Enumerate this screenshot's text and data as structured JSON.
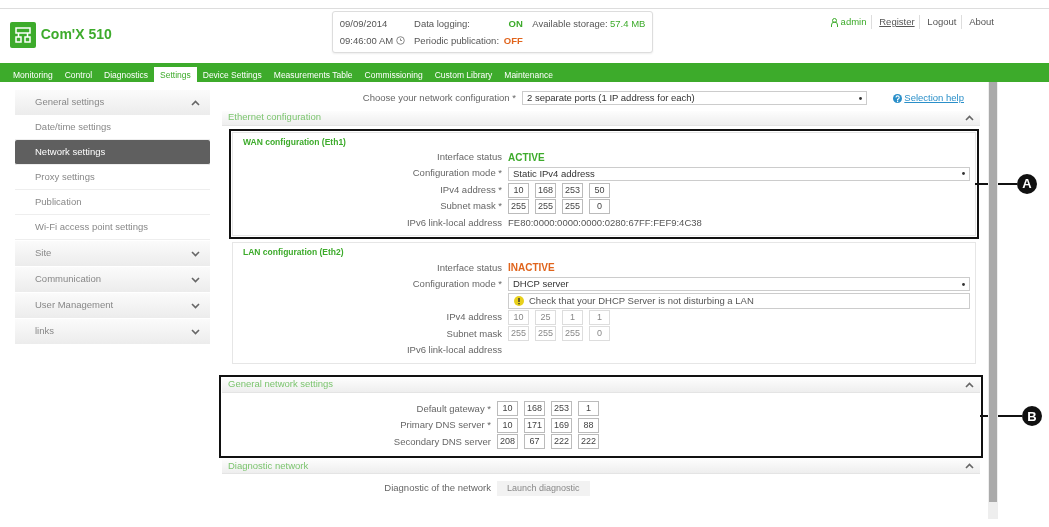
{
  "header": {
    "product": "Com'X 510",
    "date": "09/09/2014",
    "time": "09:46:00 AM",
    "status": [
      {
        "label": "Data logging:",
        "value": "ON",
        "color": "#3dab2b"
      },
      {
        "label": "Periodic publication:",
        "value": "OFF",
        "color": "#e0641c"
      }
    ],
    "storage": {
      "label": "Available storage:",
      "value": "57.4 MB"
    },
    "user": "admin",
    "links": [
      {
        "label": "Register",
        "underlined": true
      },
      {
        "label": "Logout",
        "underlined": false
      },
      {
        "label": "About",
        "underlined": false
      }
    ]
  },
  "tabs": [
    {
      "label": "Monitoring",
      "selected": false
    },
    {
      "label": "Control",
      "selected": false
    },
    {
      "label": "Diagnostics",
      "selected": false
    },
    {
      "label": "Settings",
      "selected": true
    },
    {
      "label": "Device Settings",
      "selected": false
    },
    {
      "label": "Measurements Table",
      "selected": false
    },
    {
      "label": "Commissioning",
      "selected": false
    },
    {
      "label": "Custom Library",
      "selected": false
    },
    {
      "label": "Maintenance",
      "selected": false
    }
  ],
  "sidebar": [
    {
      "kind": "group",
      "label": "General settings",
      "expanded": true
    },
    {
      "kind": "item",
      "label": "Date/time settings",
      "selected": false
    },
    {
      "kind": "item",
      "label": "Network settings",
      "selected": true
    },
    {
      "kind": "item",
      "label": "Proxy settings",
      "selected": false
    },
    {
      "kind": "item",
      "label": "Publication",
      "selected": false
    },
    {
      "kind": "item",
      "label": "Wi-Fi access point settings",
      "selected": false
    },
    {
      "kind": "group",
      "label": "Site",
      "expanded": false
    },
    {
      "kind": "group",
      "label": "Communication",
      "expanded": false
    },
    {
      "kind": "group",
      "label": "User Management",
      "expanded": false
    },
    {
      "kind": "group",
      "label": "links",
      "expanded": false
    }
  ],
  "network_config": {
    "label": "Choose your network configuration",
    "mark": "*",
    "value": "2 separate ports (1 IP address for each)",
    "help": "Selection help"
  },
  "sections": [
    {
      "title": "Ethernet configuration",
      "expanded": true,
      "fieldsets": [
        {
          "legend": "WAN configuration (Eth1)",
          "callout": "A",
          "rows": [
            {
              "kind": "status",
              "label": "Interface status",
              "value": "ACTIVE",
              "color": "#3dab2b"
            },
            {
              "kind": "select",
              "label": "Configuration mode",
              "mark": "*",
              "value": "Static IPv4 address"
            },
            {
              "kind": "ip",
              "label": "IPv4 address",
              "mark": "*",
              "disabled": false,
              "octets": [
                "10",
                "168",
                "253",
                "50"
              ]
            },
            {
              "kind": "ip",
              "label": "Subnet mask",
              "mark": "*",
              "disabled": false,
              "octets": [
                "255",
                "255",
                "255",
                "0"
              ]
            },
            {
              "kind": "text",
              "label": "IPv6 link-local address",
              "value": "FE80:0000:0000:0000:0280:67FF:FEF9:4C38"
            }
          ]
        },
        {
          "legend": "LAN configuration (Eth2)",
          "rows": [
            {
              "kind": "status",
              "label": "Interface status",
              "value": "INACTIVE",
              "color": "#e0641c"
            },
            {
              "kind": "select",
              "label": "Configuration mode",
              "mark": "*",
              "value": "DHCP server"
            },
            {
              "kind": "notice",
              "value": "Check that your DHCP Server is not disturbing a LAN"
            },
            {
              "kind": "ip",
              "label": "IPv4 address",
              "disabled": true,
              "octets": [
                "10",
                "25",
                "1",
                "1"
              ]
            },
            {
              "kind": "ip",
              "label": "Subnet mask",
              "disabled": true,
              "octets": [
                "255",
                "255",
                "255",
                "0"
              ]
            },
            {
              "kind": "text",
              "label": "IPv6 link-local address"
            }
          ]
        }
      ]
    },
    {
      "title": "General network settings",
      "expanded": true,
      "callout": "B",
      "rows": [
        {
          "kind": "ip",
          "label": "Default gateway",
          "mark": "*",
          "disabled": false,
          "octets": [
            "10",
            "168",
            "253",
            "1"
          ]
        },
        {
          "kind": "ip",
          "label": "Primary DNS server",
          "mark": "*",
          "disabled": false,
          "octets": [
            "10",
            "171",
            "169",
            "88"
          ]
        },
        {
          "kind": "ip",
          "label": "Secondary DNS server",
          "disabled": false,
          "octets": [
            "208",
            "67",
            "222",
            "222"
          ]
        }
      ]
    },
    {
      "title": "Diagnostic network",
      "expanded": true,
      "rows": [
        {
          "kind": "button",
          "label": "Diagnostic of the network",
          "value": "Launch diagnostic",
          "disabled": true
        }
      ]
    }
  ]
}
